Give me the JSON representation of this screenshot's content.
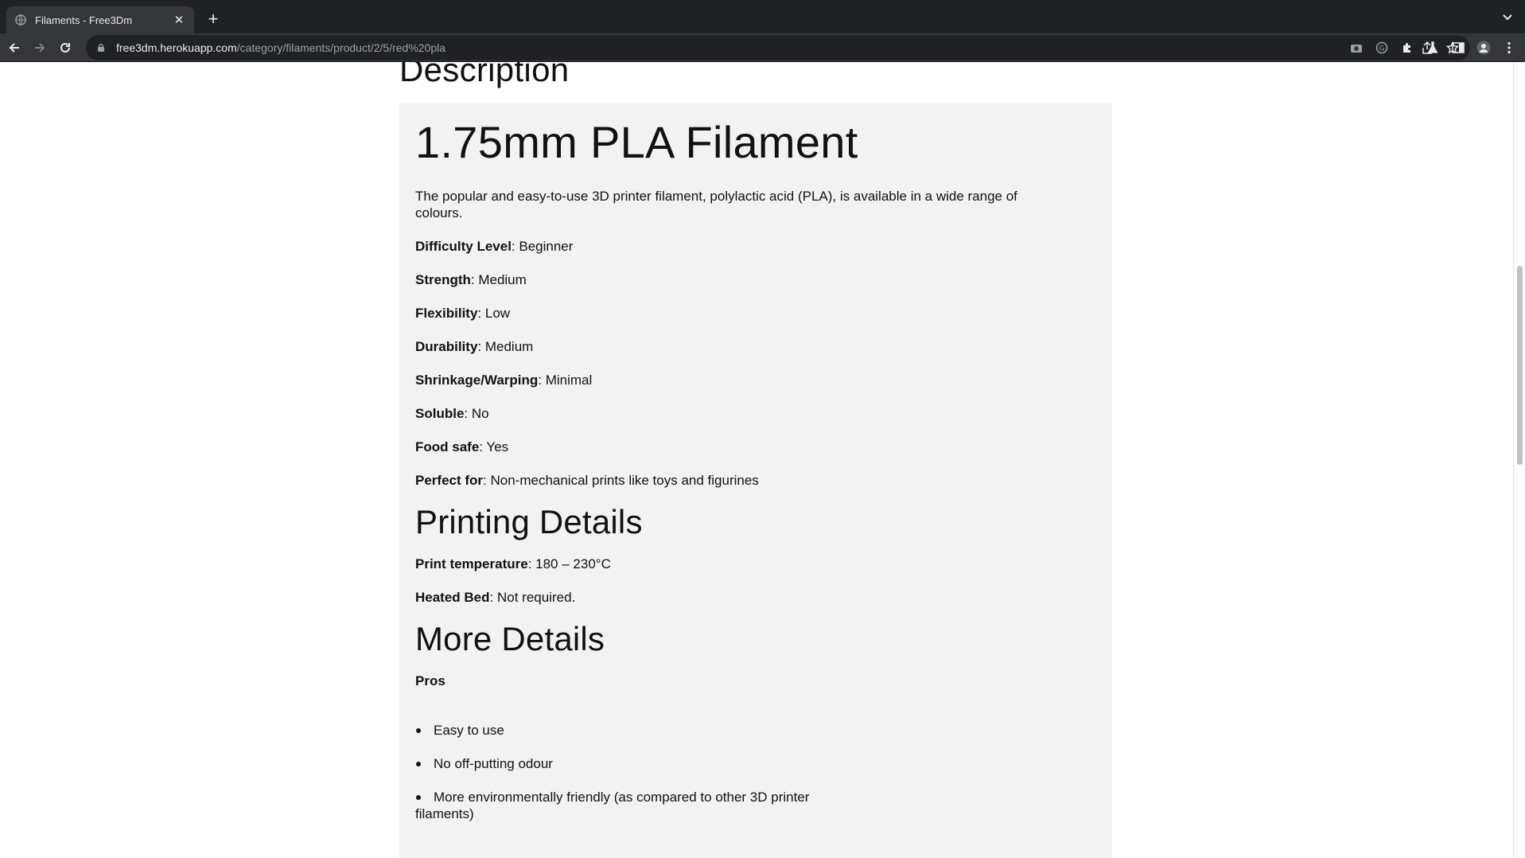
{
  "browser": {
    "tab_title": "Filaments - Free3Dm",
    "url_host": "free3dm.herokuapp.com",
    "url_path": "/category/filaments/product/2/5/red%20pla"
  },
  "page": {
    "description_heading": "Description",
    "product_title": "1.75mm PLA Filament",
    "intro": "The popular and easy-to-use 3D printer filament, polylactic acid (PLA), is available in a wide range of colours.",
    "properties": [
      {
        "label": "Difficulty Level",
        "value": ": Beginner"
      },
      {
        "label": "Strength",
        "value": ": Medium"
      },
      {
        "label": "Flexibility",
        "value": ": Low"
      },
      {
        "label": "Durability",
        "value": ": Medium"
      },
      {
        "label": "Shrinkage/Warping",
        "value": ": Minimal"
      },
      {
        "label": "Soluble",
        "value": ": No"
      },
      {
        "label": "Food safe",
        "value": ": Yes"
      },
      {
        "label": "Perfect for",
        "value": ": Non-mechanical prints like toys and figurines"
      }
    ],
    "printing_heading": "Printing Details",
    "printing": [
      {
        "label": "Print temperature",
        "value": ": 180 – 230°C"
      },
      {
        "label": "Heated Bed",
        "value": ": Not required."
      }
    ],
    "more_heading": "More Details",
    "pros_label": "Pros",
    "pros": [
      "Easy to use",
      "No off-putting odour",
      "More environmentally friendly (as compared to other 3D printer filaments)"
    ]
  },
  "icons": [
    "globe-icon",
    "close-icon",
    "plus-icon",
    "chevron-down-icon",
    "back-arrow-icon",
    "forward-arrow-icon",
    "reload-icon",
    "lock-icon",
    "share-icon",
    "star-icon",
    "camera-icon",
    "extension-icon",
    "puzzle-icon",
    "flask-icon",
    "sidebar-icon",
    "profile-icon",
    "menu-dots-icon"
  ],
  "colors": {
    "chrome_dark": "#202124",
    "chrome_toolbar": "#35363a",
    "panel_bg": "#f2f2f2",
    "text": "#111111"
  }
}
